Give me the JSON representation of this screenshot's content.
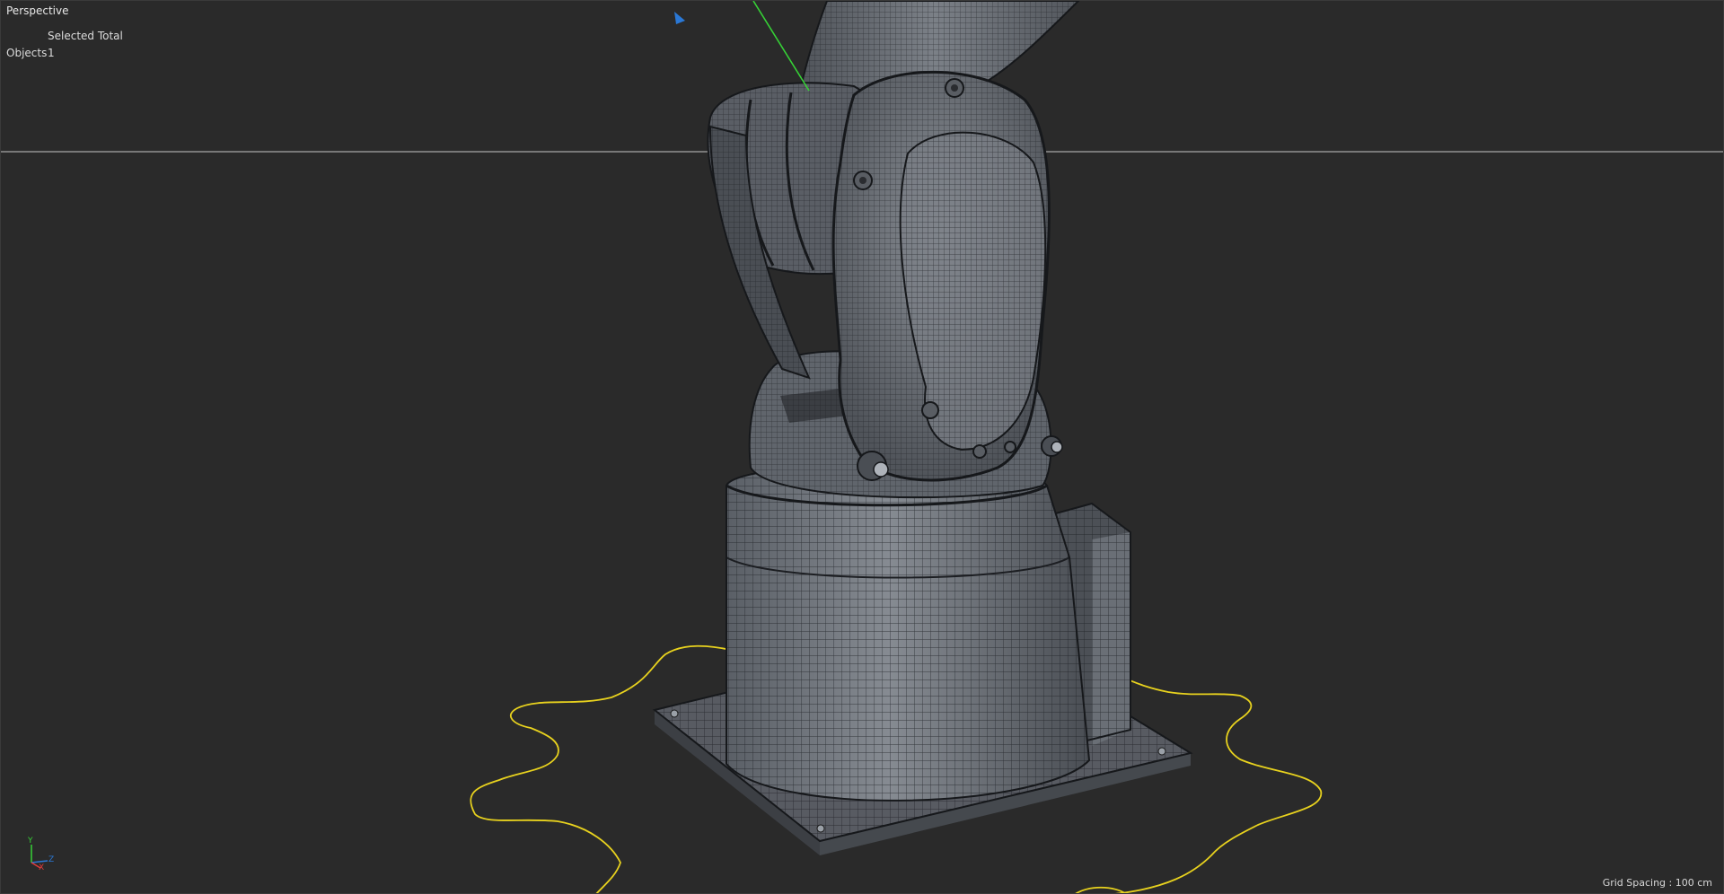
{
  "viewport": {
    "view_name": "Perspective",
    "stats": {
      "header": "Selected Total",
      "row_label": "Objects",
      "row_value": "1"
    },
    "grid_spacing": "Grid Spacing : 100 cm",
    "axis_labels": {
      "y": "Y",
      "z": "Z",
      "x": "X"
    }
  },
  "colors": {
    "background": "#2a2a2a",
    "horizon_line": "#bdbdbd",
    "mesh_fill": "#6b7077",
    "wire": "#1c1e22",
    "spline": "#e8d21e",
    "y_axis": "#36d136",
    "z_axis_handle": "#2a78d6"
  },
  "icons": [
    "axis-gizmo-icon",
    "move-handle-icon"
  ]
}
